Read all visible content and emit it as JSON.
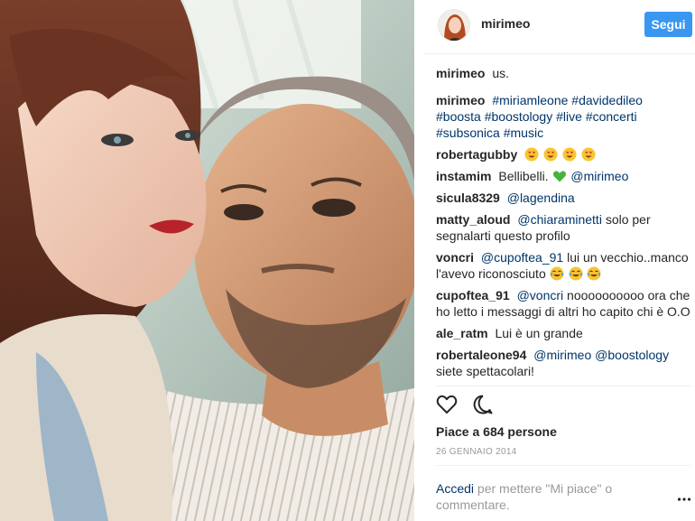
{
  "header": {
    "username": "mirimeo",
    "follow_label": "Segui"
  },
  "caption": {
    "user": "mirimeo",
    "text": "us."
  },
  "hashtags_comment": {
    "user": "mirimeo",
    "tags": [
      "#miriamleone",
      "#davidedileo",
      "#boosta",
      "#boostology",
      "#live",
      "#concerti",
      "#subsonica",
      "#music"
    ]
  },
  "comments": [
    {
      "user": "robertagubby",
      "emoji": [
        "heart-eyes-emoji",
        "heart-eyes-emoji",
        "heart-eyes-emoji",
        "heart-eyes-emoji"
      ]
    },
    {
      "user": "instamim",
      "text": "Bellibelli.",
      "emoji_after": "green-heart-emoji",
      "mention": "@mirimeo"
    },
    {
      "user": "sicula8329",
      "mention": "@lagendina"
    },
    {
      "user": "matty_aloud",
      "mention": "@chiaraminetti",
      "text": "solo per segnalarti questo profilo"
    },
    {
      "user": "voncri",
      "mention": "@cupoftea_91",
      "text": "lui un vecchio..manco l'avevo riconosciuto",
      "emoji": [
        "crying-laughing-emoji",
        "crying-laughing-emoji",
        "crying-laughing-emoji"
      ]
    },
    {
      "user": "cupoftea_91",
      "mention": "@voncri",
      "text": "noooooooooo ora che ho letto i messaggi di altri ho capito chi è O.O"
    },
    {
      "user": "ale_ratm",
      "text": "Lui è un grande"
    },
    {
      "user": "robertaleone94",
      "mention": "@mirimeo",
      "mention2": "@boostology",
      "text": "siete spettacolari!"
    }
  ],
  "actions": {
    "like_icon": "heart-outline-icon",
    "comment_icon": "speech-bubble-icon"
  },
  "likes_text": "Piace a 684 persone",
  "date": "26 GENNAIO 2014",
  "login": {
    "link": "Accedi",
    "text": "per mettere \"Mi piace\" o commentare."
  },
  "more_icon": "ellipsis-icon",
  "colors": {
    "accent": "#3897f0",
    "link": "#003569",
    "muted": "#999999"
  }
}
